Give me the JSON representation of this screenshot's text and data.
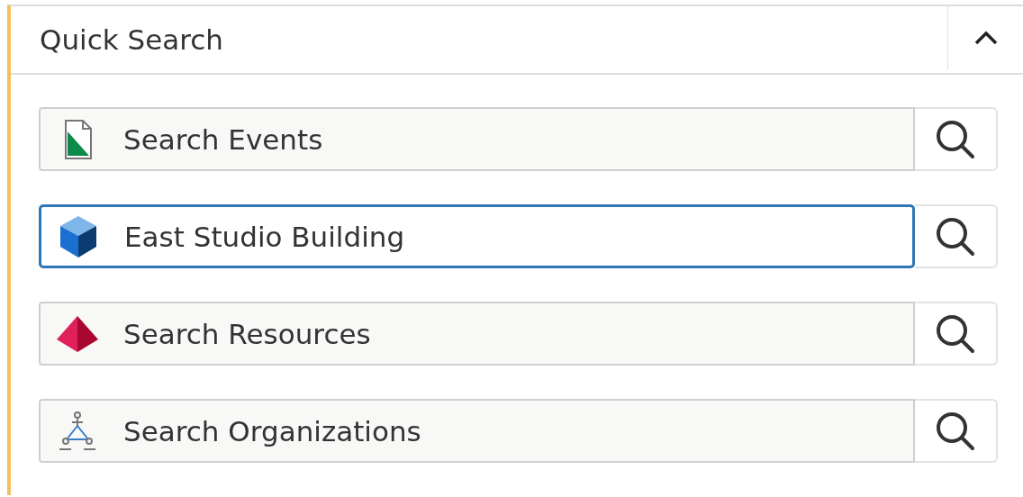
{
  "panel": {
    "title": "Quick Search",
    "expanded": true
  },
  "fields": [
    {
      "kind": "events",
      "placeholder": "Search Events",
      "focused": false
    },
    {
      "kind": "locations",
      "value": "East Studio Building",
      "focused": true
    },
    {
      "kind": "resources",
      "placeholder": "Search Resources",
      "focused": false
    },
    {
      "kind": "organizations",
      "placeholder": "Search Organizations",
      "focused": false
    }
  ]
}
